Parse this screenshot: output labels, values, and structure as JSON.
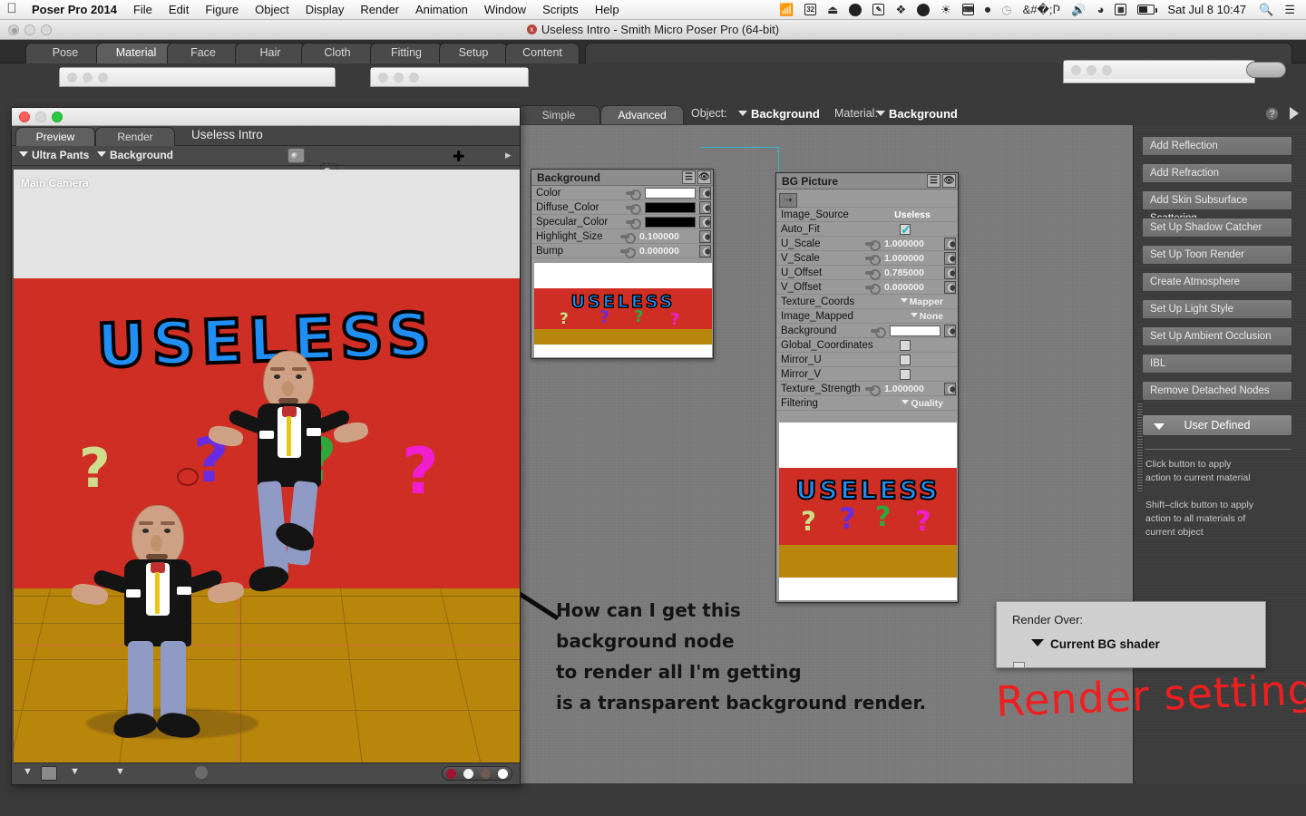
{
  "menubar": {
    "apple": "apple-logo",
    "app_name": "Poser Pro 2014",
    "items": [
      "File",
      "Edit",
      "Figure",
      "Object",
      "Display",
      "Render",
      "Animation",
      "Window",
      "Scripts",
      "Help"
    ],
    "status_icons": [
      "airplay-icon",
      "32-bit-icon",
      "eject-icon",
      "sync-icon",
      "notes-icon",
      "dropbox-icon",
      "globe-icon",
      "growl-icon",
      "printer-icon",
      "flash-icon",
      "timemachine-icon",
      "bluetooth-icon",
      "volume-icon",
      "wifi-icon",
      "keyboard-icon",
      "battery-icon"
    ],
    "clock": "Sat Jul 8  10:47",
    "search_icon": "search-icon",
    "notification_icon": "list-icon"
  },
  "window": {
    "title": "Useless Intro - Smith Micro Poser Pro  (64-bit)",
    "room_tabs": [
      "Pose",
      "Material",
      "Face",
      "Hair",
      "Cloth",
      "Fitting",
      "Setup",
      "Content"
    ],
    "active_room": "Material"
  },
  "material_room": {
    "tabs": [
      "Simple",
      "Advanced"
    ],
    "active_tab": "Advanced",
    "object_label": "Object:",
    "object_value": "Background",
    "material_label": "Material:",
    "material_value": "Background",
    "help_icon": "help-icon",
    "expand_icon": "expand-right-icon"
  },
  "background_node": {
    "title": "Background",
    "menu_icon": "node-menu-icon",
    "eye_icon": "node-preview-icon",
    "rows": [
      {
        "label": "Color",
        "type": "swatch",
        "color": "#ffffff",
        "connected": true
      },
      {
        "label": "Diffuse_Color",
        "type": "swatch",
        "color": "#000000",
        "connected": false
      },
      {
        "label": "Specular_Color",
        "type": "swatch",
        "color": "#000000",
        "connected": false
      },
      {
        "label": "Highlight_Size",
        "type": "number",
        "value": "0.100000"
      },
      {
        "label": "Bump",
        "type": "number",
        "value": "0.000000"
      }
    ],
    "preview_word": "USELESS",
    "preview_marks": [
      "?",
      "?",
      "?",
      "?"
    ]
  },
  "bg_picture_node": {
    "title": "BG Picture",
    "menu_icon": "node-menu-icon",
    "eye_icon": "node-preview-icon",
    "thumb_icon": "image-thumbnail-icon",
    "rows": [
      {
        "label": "Image_Source",
        "type": "text",
        "value": "Useless"
      },
      {
        "label": "Auto_Fit",
        "type": "checkbox",
        "value": true
      },
      {
        "label": "U_Scale",
        "type": "number",
        "value": "1.000000"
      },
      {
        "label": "V_Scale",
        "type": "number",
        "value": "1.000000"
      },
      {
        "label": "U_Offset",
        "type": "number",
        "value": "0.785000"
      },
      {
        "label": "V_Offset",
        "type": "number",
        "value": "0.000000"
      },
      {
        "label": "Texture_Coords",
        "type": "dropdown",
        "value": "Mapper"
      },
      {
        "label": "Image_Mapped",
        "type": "dropdown",
        "value": "None"
      },
      {
        "label": "Background",
        "type": "swatch",
        "color": "#ffffff"
      },
      {
        "label": "Global_Coordinates",
        "type": "checkbox",
        "value": false
      },
      {
        "label": "Mirror_U",
        "type": "checkbox",
        "value": false
      },
      {
        "label": "Mirror_V",
        "type": "checkbox",
        "value": false
      },
      {
        "label": "Texture_Strength",
        "type": "number",
        "value": "1.000000"
      },
      {
        "label": "Filtering",
        "type": "dropdown",
        "value": "Quality"
      }
    ],
    "preview_word": "USELESS",
    "preview_marks": [
      "?",
      "?",
      "?",
      "?"
    ]
  },
  "side_panel": {
    "buttons": [
      "Add Reflection",
      "Add Refraction",
      "Add Skin Subsurface Scattering",
      "Set Up Shadow Catcher",
      "Set Up Toon Render",
      "Create Atmosphere",
      "Set Up Light Style",
      "Set Up Ambient Occlusion",
      "IBL",
      "Remove Detached Nodes"
    ],
    "user_defined": "User Defined",
    "hints": [
      "Click button to apply",
      "action to current material",
      "Shift–click button to apply",
      "action to all materials of",
      "current object"
    ]
  },
  "render_over": {
    "label": "Render Over:",
    "value": "Current BG shader"
  },
  "annotations": {
    "question": [
      "How can I get this",
      "background node",
      "to render all I'm getting",
      "is a transparent background render."
    ],
    "red_note": "Render  setting"
  },
  "preview_window": {
    "tabs": [
      "Preview",
      "Render"
    ],
    "active_tab": "Preview",
    "document_name": "Useless",
    "document_name_full": "Useless Intro",
    "selector_figure": "Ultra Pants",
    "selector_actor": "Background",
    "camera_label": "Main Camera",
    "toolbar_icons": [
      "camera-icon",
      "camera-select-icon",
      "light-ball-icon",
      "shading-icon",
      "globe-icon",
      "move-icon",
      "light-icon",
      "next-arrow-icon"
    ],
    "bottom_icons": [
      "chevron-down-icon",
      "document-style-icon",
      "chevron-down-icon",
      "figure-style-icon",
      "chevron-down-icon",
      "element-style-icon",
      "spheres-icon",
      "ground-shadow-icon"
    ],
    "scene_word": "USELESS",
    "scene_marks": [
      "?",
      "?",
      "?",
      "?"
    ]
  },
  "colors": {
    "scene_red": "#cf2e24",
    "scene_gold": "#b8860b",
    "word_blue": "#1f8ff5",
    "annotation_red": "#f01f1f",
    "wire_cyan": "#2fb8c4",
    "check_cyan": "#16b4c8"
  }
}
